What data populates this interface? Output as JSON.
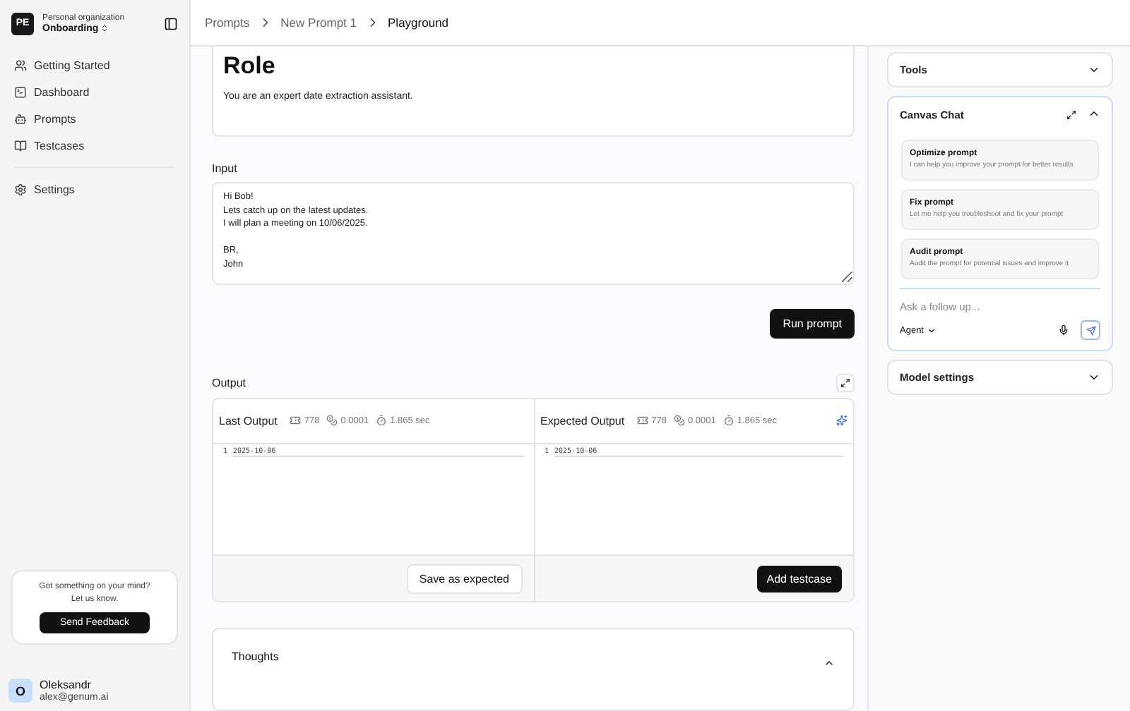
{
  "sidebar": {
    "org_avatar": "PE",
    "org_label": "Personal organization",
    "workspace": "Onboarding",
    "items": [
      {
        "label": "Getting Started",
        "selected": false
      },
      {
        "label": "Dashboard",
        "selected": false
      },
      {
        "label": "Prompts",
        "selected": false
      },
      {
        "label": "Testcases",
        "selected": false
      },
      {
        "label": "Settings",
        "selected": false
      }
    ],
    "feedback": {
      "text": "Got something on your mind? Let us know.",
      "button": "Send Feedback"
    },
    "user": {
      "initial": "O",
      "name": "Oleksandr",
      "email": "alex@genum.ai"
    }
  },
  "breadcrumbs": [
    "Prompts",
    "New Prompt 1",
    "Playground"
  ],
  "prompt": {
    "heading": "Role",
    "text": "You are an expert date extraction assistant."
  },
  "input": {
    "label": "Input",
    "value": "Hi Bob!\nLets catch up on the latest updates.\nI will plan a meeting on 10/06/2025.\n\nBR,\nJohn"
  },
  "run_button": "Run prompt",
  "output": {
    "label": "Output",
    "panels": [
      {
        "title": "Last Output",
        "tokens": "778",
        "cost": "0.0001",
        "time": "1.865 sec",
        "line_number": "1",
        "code": "2025-10-06",
        "button": "Save as expected",
        "primary": false,
        "sparkle": false
      },
      {
        "title": "Expected Output",
        "tokens": "778",
        "cost": "0.0001",
        "time": "1.865 sec",
        "line_number": "1",
        "code": "2025-10-06",
        "button": "Add testcase",
        "primary": true,
        "sparkle": true
      }
    ]
  },
  "thoughts": {
    "title": "Thoughts",
    "expanded": true
  },
  "right_panel": {
    "tools": {
      "title": "Tools",
      "expanded": false
    },
    "chat": {
      "title": "Canvas Chat",
      "expanded": true,
      "suggestions": [
        {
          "title": "Optimize prompt",
          "text": "I can help you improve your prompt for better results"
        },
        {
          "title": "Fix prompt",
          "text": "Let me help you troubleshoot and fix your prompt"
        },
        {
          "title": "Audit prompt",
          "text": "Audit the prompt for potential issues and improve it"
        }
      ],
      "placeholder": "Ask a follow up...",
      "mode": "Agent"
    },
    "model_settings": {
      "title": "Model settings",
      "expanded": false
    }
  }
}
